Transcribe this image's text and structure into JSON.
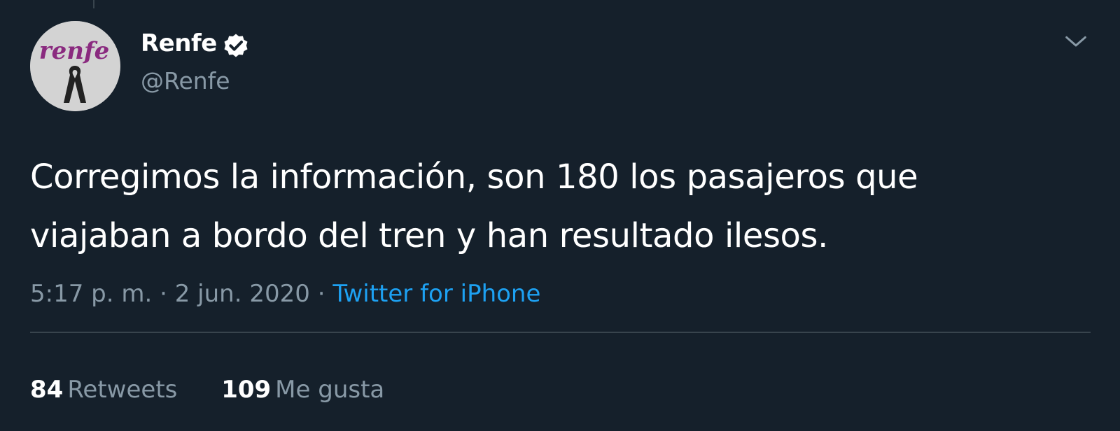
{
  "author": {
    "display_name": "Renfe",
    "handle": "@Renfe",
    "verified": true,
    "avatar_logo_text": "renfe",
    "avatar_icon": "black-ribbon-icon"
  },
  "tweet": {
    "text_lines": [
      "Corregimos la información, son 180 los pasajeros que",
      "viajaban a bordo del tren y han resultado ilesos."
    ],
    "time": "5:17 p. m.",
    "separator": "·",
    "date": "2 jun. 2020",
    "source": "Twitter for iPhone"
  },
  "stats": {
    "retweets_count": "84",
    "retweets_label": "Retweets",
    "likes_count": "109",
    "likes_label": "Me gusta"
  },
  "icons": {
    "verified": "verified-badge-icon",
    "menu": "chevron-down-icon"
  },
  "colors": {
    "background": "#15202b",
    "text_primary": "#ffffff",
    "text_secondary": "#8899a6",
    "link": "#1da1f2",
    "divider": "#38444d",
    "brand": "#8a2a7f"
  }
}
